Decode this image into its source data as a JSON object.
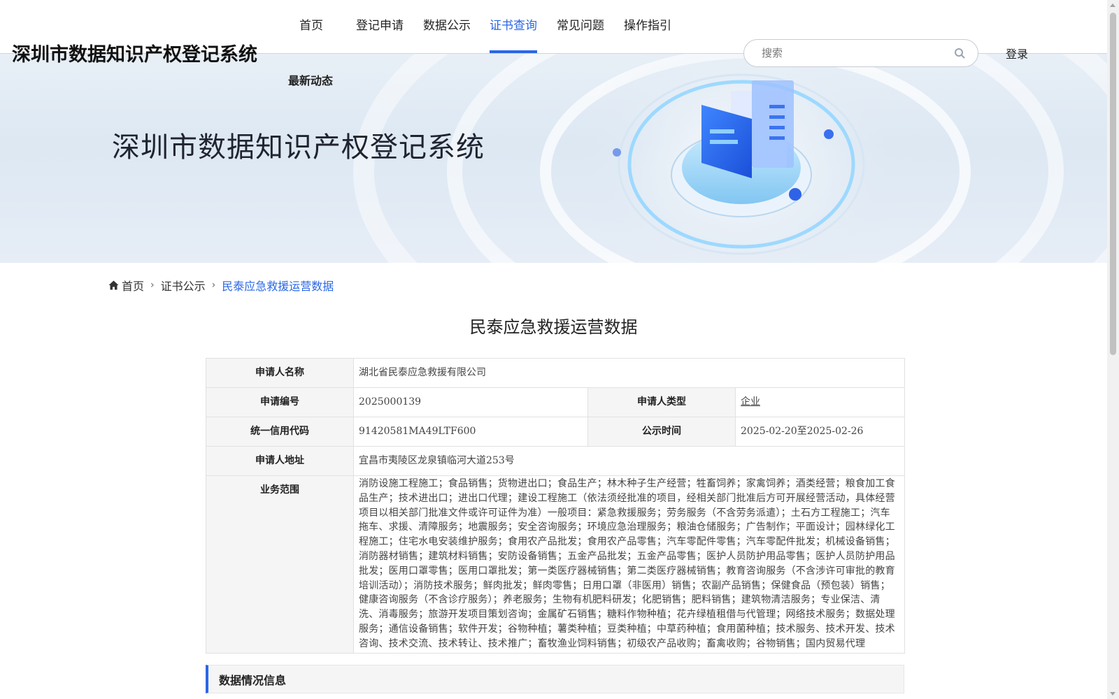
{
  "header": {
    "site_title": "深圳市数据知识产权登记系统",
    "nav": [
      {
        "label": "首页"
      },
      {
        "label": "登记申请"
      },
      {
        "label": "数据公示"
      },
      {
        "label": "证书查询",
        "active": true
      },
      {
        "label": "常见问题"
      },
      {
        "label": "操作指引"
      }
    ],
    "nav_second": "最新动态",
    "search_placeholder": "搜索",
    "login": "登录"
  },
  "banner": {
    "title": "深圳市数据知识产权登记系统"
  },
  "breadcrumb": {
    "items": [
      "首页",
      "证书公示",
      "民泰应急救援运营数据"
    ]
  },
  "detail": {
    "title": "民泰应急救援运营数据",
    "labels": {
      "applicant_name": "申请人名称",
      "application_no": "申请编号",
      "applicant_type": "申请人类型",
      "credit_code": "统一信用代码",
      "publicity_time": "公示时间",
      "address": "申请人地址",
      "business_scope": "业务范围"
    },
    "values": {
      "applicant_name": "湖北省民泰应急救援有限公司",
      "application_no": "2025000139",
      "applicant_type": "企业",
      "credit_code": "91420581MA49LTF600",
      "publicity_time": "2025-02-20至2025-02-26",
      "address": "宜昌市夷陵区龙泉镇临河大道253号",
      "business_scope": "消防设施工程施工；食品销售；货物进出口；食品生产；林木种子生产经营；牲畜饲养；家禽饲养；酒类经营；粮食加工食品生产；技术进出口；进出口代理；建设工程施工（依法须经批准的项目，经相关部门批准后方可开展经营活动，具体经营项目以相关部门批准文件或许可证件为准）一般项目：紧急救援服务；劳务服务（不含劳务派遣）；土石方工程施工；汽车拖车、求援、清障服务；地震服务；安全咨询服务；环境应急治理服务；粮油仓储服务；广告制作；平面设计；园林绿化工程施工；住宅水电安装维护服务；食用农产品批发；食用农产品零售；汽车零配件零售；汽车零配件批发；机械设备销售；消防器材销售；建筑材料销售；安防设备销售；五金产品批发；五金产品零售；医护人员防护用品零售；医护人员防护用品批发；医用口罩零售；医用口罩批发；第一类医疗器械销售；第二类医疗器械销售；教育咨询服务（不含涉许可审批的教育培训活动）；消防技术服务；鲜肉批发；鲜肉零售；日用口罩（非医用）销售；农副产品销售；保健食品（预包装）销售；健康咨询服务（不含诊疗服务）；养老服务；生物有机肥料研发；化肥销售；肥料销售；建筑物清洁服务；专业保洁、清洗、消毒服务；旅游开发项目策划咨询；金属矿石销售；糖料作物种植；花卉绿植租借与代管理；网络技术服务；数据处理服务；通信设备销售；软件开发；谷物种植；薯类种植；豆类种植；中草药种植；食用菌种植；技术服务、技术开发、技术咨询、技术交流、技术转让、技术推广；畜牧渔业饲料销售；初级农产品收购；畜禽收购；谷物销售；国内贸易代理"
    },
    "section_title": "数据情况信息"
  },
  "colors": {
    "accent": "#2a67e6",
    "label_bg": "#f5f5f5"
  }
}
